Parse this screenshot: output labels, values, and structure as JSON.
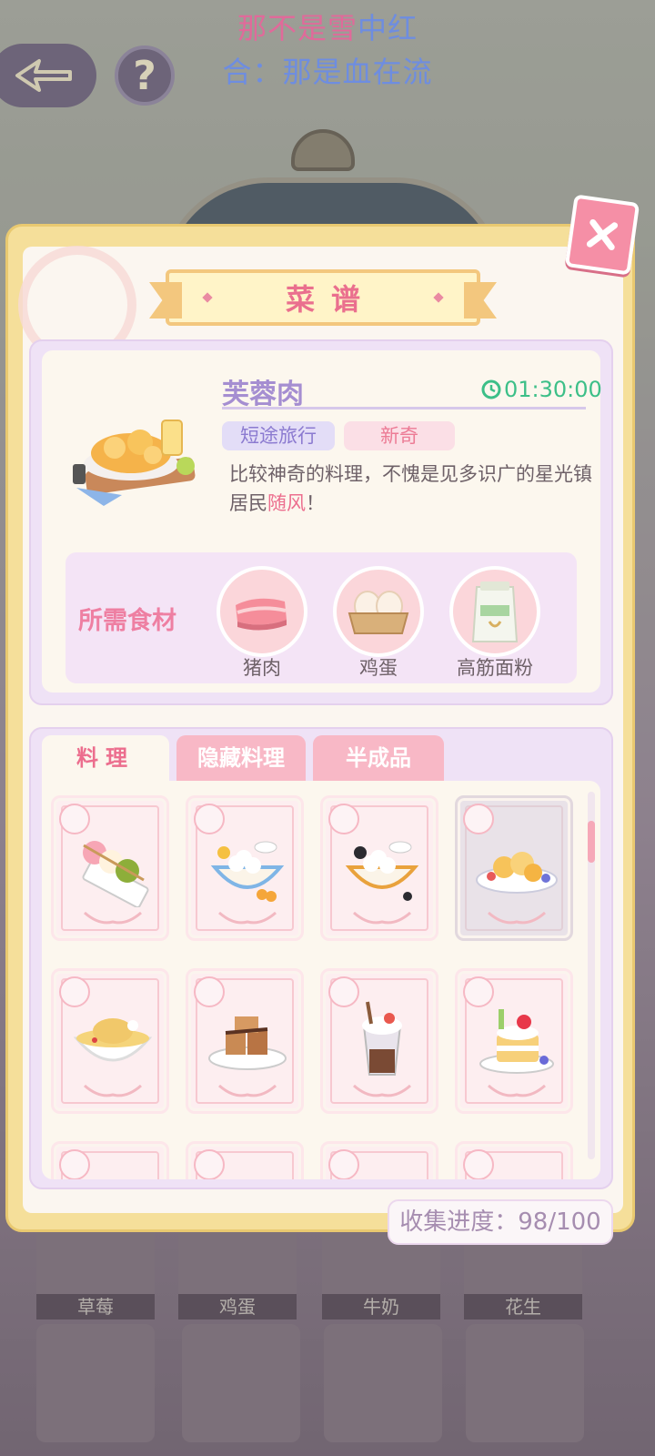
{
  "lyrics": {
    "line1_pink_a": "那不是雪",
    "line1_blue": "中红",
    "line2": "合：那是血在流"
  },
  "hud": {
    "help": "?"
  },
  "background_items": [
    "草莓",
    "鸡蛋",
    "牛奶",
    "花生"
  ],
  "panel": {
    "title": "菜谱",
    "close": "✕"
  },
  "detail": {
    "name": "芙蓉肉",
    "time": "01:30:00",
    "tags": [
      "短途旅行",
      "新奇"
    ],
    "desc_before": "比较神奇的料理，不愧是见多识广的星光镇居民",
    "desc_highlight": "随风",
    "desc_after": "！",
    "ingredients_title": "所需食材",
    "ingredients": [
      "猪肉",
      "鸡蛋",
      "高筋面粉"
    ]
  },
  "tabs": [
    "料理",
    "隐藏料理",
    "半成品"
  ],
  "recipes": [
    {
      "icon": "dango-icon"
    },
    {
      "icon": "tangyuan-icon"
    },
    {
      "icon": "black-sesame-tangyuan-icon"
    },
    {
      "icon": "furong-pork-icon"
    },
    {
      "icon": "chicken-soup-icon"
    },
    {
      "icon": "tiramisu-icon"
    },
    {
      "icon": "parfait-icon"
    },
    {
      "icon": "strawberry-cake-icon"
    }
  ],
  "progress": {
    "collected": 98,
    "total": 100,
    "text": "收集进度：98/100"
  },
  "colors": {
    "accent_pink": "#ec6e8e",
    "accent_purple": "#a58ed1",
    "timer_green": "#3cbf88",
    "panel_gold": "#f5df9a"
  }
}
